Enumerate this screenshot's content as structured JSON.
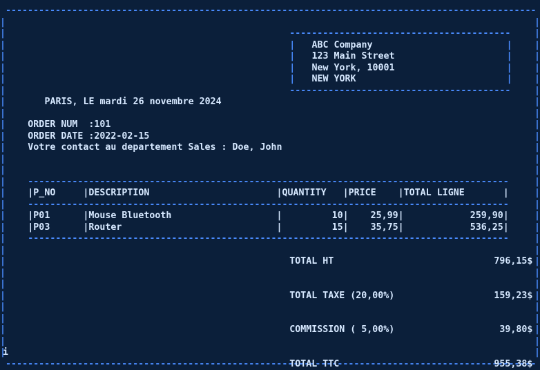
{
  "company": {
    "name": "ABC Company",
    "street": "123 Main Street",
    "city_zip": "New York, 10001",
    "state": "NEW YORK"
  },
  "place_date_line": "PARIS, LE mardi 26 novembre 2024",
  "order": {
    "num_line": "ORDER NUM  :101",
    "date_line": "ORDER DATE :2022-02-15",
    "contact_line": "Votre contact au departement Sales : Doe, John"
  },
  "table": {
    "headers": [
      "P_NO",
      "DESCRIPTION",
      "QUANTITY",
      "PRICE",
      "TOTAL LIGNE"
    ],
    "rows": [
      [
        "P01",
        "Mouse Bluetooth",
        "10",
        "25,99",
        "259,90"
      ],
      [
        "P03",
        "Router",
        "15",
        "35,75",
        "536,25"
      ]
    ]
  },
  "totals": [
    {
      "label": "TOTAL HT",
      "value": "796,15$"
    },
    {
      "label": "TOTAL TAXE (20,00%)",
      "value": "159,23$"
    },
    {
      "label": "COMMISSION ( 5,00%)",
      "value": "39,80$"
    },
    {
      "label": "TOTAL TTC",
      "value": "955,38$"
    }
  ],
  "cursor": "i",
  "colors": {
    "background": "#0b1f3a",
    "text": "#d6e8ff",
    "frame": "#4a8cff"
  }
}
